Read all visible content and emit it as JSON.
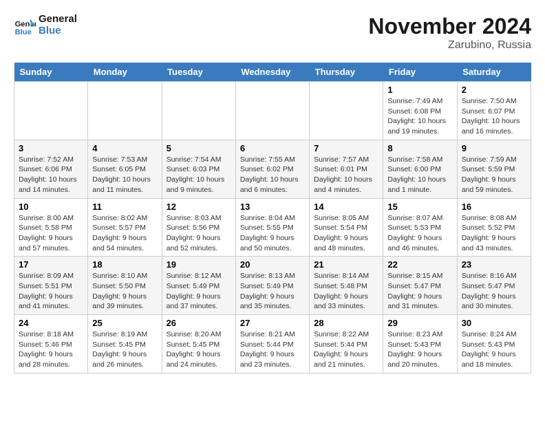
{
  "header": {
    "logo_line1": "General",
    "logo_line2": "Blue",
    "month_title": "November 2024",
    "location": "Zarubino, Russia"
  },
  "weekdays": [
    "Sunday",
    "Monday",
    "Tuesday",
    "Wednesday",
    "Thursday",
    "Friday",
    "Saturday"
  ],
  "weeks": [
    [
      {
        "day": "",
        "info": ""
      },
      {
        "day": "",
        "info": ""
      },
      {
        "day": "",
        "info": ""
      },
      {
        "day": "",
        "info": ""
      },
      {
        "day": "",
        "info": ""
      },
      {
        "day": "1",
        "info": "Sunrise: 7:49 AM\nSunset: 6:08 PM\nDaylight: 10 hours and 19 minutes."
      },
      {
        "day": "2",
        "info": "Sunrise: 7:50 AM\nSunset: 6:07 PM\nDaylight: 10 hours and 16 minutes."
      }
    ],
    [
      {
        "day": "3",
        "info": "Sunrise: 7:52 AM\nSunset: 6:06 PM\nDaylight: 10 hours and 14 minutes."
      },
      {
        "day": "4",
        "info": "Sunrise: 7:53 AM\nSunset: 6:05 PM\nDaylight: 10 hours and 11 minutes."
      },
      {
        "day": "5",
        "info": "Sunrise: 7:54 AM\nSunset: 6:03 PM\nDaylight: 10 hours and 9 minutes."
      },
      {
        "day": "6",
        "info": "Sunrise: 7:55 AM\nSunset: 6:02 PM\nDaylight: 10 hours and 6 minutes."
      },
      {
        "day": "7",
        "info": "Sunrise: 7:57 AM\nSunset: 6:01 PM\nDaylight: 10 hours and 4 minutes."
      },
      {
        "day": "8",
        "info": "Sunrise: 7:58 AM\nSunset: 6:00 PM\nDaylight: 10 hours and 1 minute."
      },
      {
        "day": "9",
        "info": "Sunrise: 7:59 AM\nSunset: 5:59 PM\nDaylight: 9 hours and 59 minutes."
      }
    ],
    [
      {
        "day": "10",
        "info": "Sunrise: 8:00 AM\nSunset: 5:58 PM\nDaylight: 9 hours and 57 minutes."
      },
      {
        "day": "11",
        "info": "Sunrise: 8:02 AM\nSunset: 5:57 PM\nDaylight: 9 hours and 54 minutes."
      },
      {
        "day": "12",
        "info": "Sunrise: 8:03 AM\nSunset: 5:56 PM\nDaylight: 9 hours and 52 minutes."
      },
      {
        "day": "13",
        "info": "Sunrise: 8:04 AM\nSunset: 5:55 PM\nDaylight: 9 hours and 50 minutes."
      },
      {
        "day": "14",
        "info": "Sunrise: 8:05 AM\nSunset: 5:54 PM\nDaylight: 9 hours and 48 minutes."
      },
      {
        "day": "15",
        "info": "Sunrise: 8:07 AM\nSunset: 5:53 PM\nDaylight: 9 hours and 46 minutes."
      },
      {
        "day": "16",
        "info": "Sunrise: 8:08 AM\nSunset: 5:52 PM\nDaylight: 9 hours and 43 minutes."
      }
    ],
    [
      {
        "day": "17",
        "info": "Sunrise: 8:09 AM\nSunset: 5:51 PM\nDaylight: 9 hours and 41 minutes."
      },
      {
        "day": "18",
        "info": "Sunrise: 8:10 AM\nSunset: 5:50 PM\nDaylight: 9 hours and 39 minutes."
      },
      {
        "day": "19",
        "info": "Sunrise: 8:12 AM\nSunset: 5:49 PM\nDaylight: 9 hours and 37 minutes."
      },
      {
        "day": "20",
        "info": "Sunrise: 8:13 AM\nSunset: 5:49 PM\nDaylight: 9 hours and 35 minutes."
      },
      {
        "day": "21",
        "info": "Sunrise: 8:14 AM\nSunset: 5:48 PM\nDaylight: 9 hours and 33 minutes."
      },
      {
        "day": "22",
        "info": "Sunrise: 8:15 AM\nSunset: 5:47 PM\nDaylight: 9 hours and 31 minutes."
      },
      {
        "day": "23",
        "info": "Sunrise: 8:16 AM\nSunset: 5:47 PM\nDaylight: 9 hours and 30 minutes."
      }
    ],
    [
      {
        "day": "24",
        "info": "Sunrise: 8:18 AM\nSunset: 5:46 PM\nDaylight: 9 hours and 28 minutes."
      },
      {
        "day": "25",
        "info": "Sunrise: 8:19 AM\nSunset: 5:45 PM\nDaylight: 9 hours and 26 minutes."
      },
      {
        "day": "26",
        "info": "Sunrise: 8:20 AM\nSunset: 5:45 PM\nDaylight: 9 hours and 24 minutes."
      },
      {
        "day": "27",
        "info": "Sunrise: 8:21 AM\nSunset: 5:44 PM\nDaylight: 9 hours and 23 minutes."
      },
      {
        "day": "28",
        "info": "Sunrise: 8:22 AM\nSunset: 5:44 PM\nDaylight: 9 hours and 21 minutes."
      },
      {
        "day": "29",
        "info": "Sunrise: 8:23 AM\nSunset: 5:43 PM\nDaylight: 9 hours and 20 minutes."
      },
      {
        "day": "30",
        "info": "Sunrise: 8:24 AM\nSunset: 5:43 PM\nDaylight: 9 hours and 18 minutes."
      }
    ]
  ]
}
